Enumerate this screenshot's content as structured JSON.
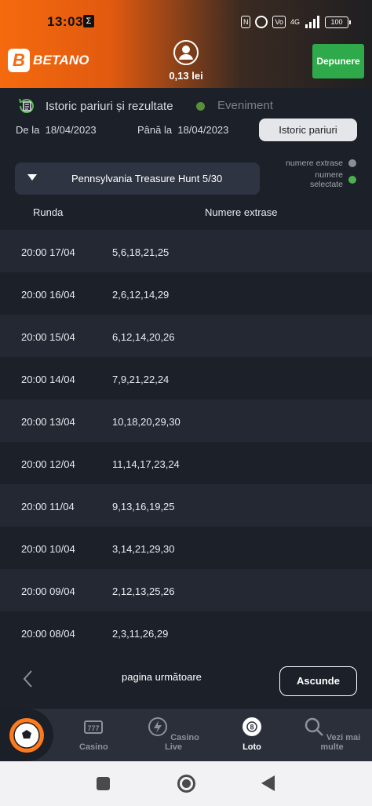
{
  "status_bar": {
    "time": "13:03",
    "sigma": "Σ",
    "battery": "100",
    "network": "4G"
  },
  "header": {
    "brand": "BETANO",
    "logo_letter": "B",
    "balance": "0,13 lei",
    "deposit_label": "Depunere"
  },
  "tabs": {
    "active": "Istoric pariuri și rezultate",
    "inactive": "Eveniment"
  },
  "filters": {
    "from_label": "De la",
    "from_date": "18/04/2023",
    "to_label": "Până la",
    "to_date": "18/04/2023",
    "history_button": "Istoric pariuri"
  },
  "game_select": {
    "value": "Pennsylvania Treasure Hunt 5/30"
  },
  "legend": {
    "extracted": "numere extrase",
    "selected_line1": "numere",
    "selected_line2": "selectate",
    "extracted_color": "#8a8e96",
    "selected_color": "#4caf50"
  },
  "table": {
    "headers": [
      "Runda",
      "Numere extrase"
    ],
    "rows": [
      {
        "round": "20:00 17/04",
        "numbers": "5,6,18,21,25"
      },
      {
        "round": "20:00 16/04",
        "numbers": "2,6,12,14,29"
      },
      {
        "round": "20:00 15/04",
        "numbers": "6,12,14,20,26"
      },
      {
        "round": "20:00 14/04",
        "numbers": "7,9,21,22,24"
      },
      {
        "round": "20:00 13/04",
        "numbers": "10,18,20,29,30"
      },
      {
        "round": "20:00 12/04",
        "numbers": "11,14,17,23,24"
      },
      {
        "round": "20:00 11/04",
        "numbers": "9,13,16,19,25"
      },
      {
        "round": "20:00 10/04",
        "numbers": "3,14,21,29,30"
      },
      {
        "round": "20:00 09/04",
        "numbers": "2,12,13,25,26"
      },
      {
        "round": "20:00 08/04",
        "numbers": "2,3,11,26,29"
      }
    ]
  },
  "pager": {
    "next_label": "pagina următoare",
    "hide_label": "Ascunde"
  },
  "bottom_nav": {
    "items": [
      "Casino",
      "Casino Live",
      "Loto",
      "Vezi mai multe"
    ],
    "active": "Loto"
  },
  "colors": {
    "brand_orange": "#f56a0e",
    "deposit_green": "#2eaa4a",
    "background": "#1c2029"
  }
}
